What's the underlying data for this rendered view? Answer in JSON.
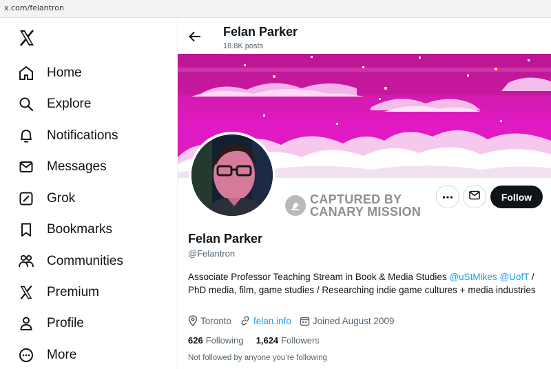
{
  "browser": {
    "url": "x.com/felantron"
  },
  "sidebar": {
    "logo": "x-logo-icon",
    "items": [
      {
        "label": "Home",
        "icon": "home-icon"
      },
      {
        "label": "Explore",
        "icon": "search-icon"
      },
      {
        "label": "Notifications",
        "icon": "bell-icon"
      },
      {
        "label": "Messages",
        "icon": "envelope-icon"
      },
      {
        "label": "Grok",
        "icon": "grok-icon"
      },
      {
        "label": "Bookmarks",
        "icon": "bookmark-icon"
      },
      {
        "label": "Communities",
        "icon": "communities-icon"
      },
      {
        "label": "Premium",
        "icon": "x-logo-icon"
      },
      {
        "label": "Profile",
        "icon": "person-icon"
      },
      {
        "label": "More",
        "icon": "more-circle-icon"
      }
    ]
  },
  "header": {
    "title": "Felan Parker",
    "posts": "18.8K posts"
  },
  "watermark": {
    "line1": "CAPTURED BY",
    "line2": "CANARY MISSION"
  },
  "actions": {
    "follow_label": "Follow"
  },
  "profile": {
    "name": "Felan Parker",
    "handle": "@Felantron",
    "bio_prefix": "Associate Professor Teaching Stream in Book & Media Studies ",
    "bio_link1": "@uStMikes",
    "bio_space": " ",
    "bio_link2": "@UofT",
    "bio_suffix": " / PhD media, film, game studies / Researching indie game cultures + media industries",
    "location": "Toronto",
    "website": "felan.info",
    "joined": "Joined August 2009",
    "following_count": "626",
    "following_label": "Following",
    "followers_count": "1,624",
    "followers_label": "Followers",
    "not_followed": "Not followed by anyone you’re following"
  },
  "colors": {
    "accent": "#1d9bf0",
    "banner": "#d41ab0",
    "text": "#0f1419",
    "muted": "#536471"
  }
}
